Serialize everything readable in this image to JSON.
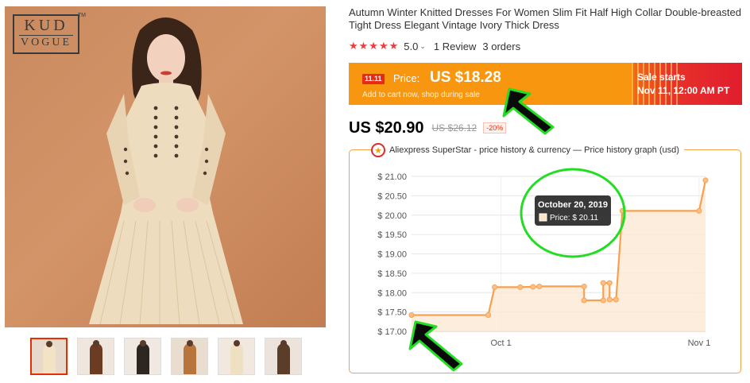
{
  "brand": {
    "logo_top": "KUD",
    "logo_bottom": "VOGUE",
    "logo_tm": "TM"
  },
  "product": {
    "title": "Autumn Winter Knitted Dresses For Women Slim Fit Half High Collar Double-breasted Tight Dress Elegant Vintage Ivory Thick Dress",
    "stars": "★★★★★",
    "rating": "5.0",
    "reviews": "1 Review",
    "orders": "3 orders",
    "current_price": "US $20.90",
    "old_price": "US $26.12",
    "discount": "-20%"
  },
  "sale": {
    "badge": "11.11",
    "price_label": "Price:",
    "price": "US $18.28",
    "subtitle": "Add to cart now, shop during sale",
    "starts_label": "Sale starts",
    "starts_date": "Nov 11, 12:00 AM PT"
  },
  "history": {
    "title": "Aliexpress SuperStar - price history & currency — Price history graph (usd)",
    "tooltip_date": "October 20, 2019",
    "tooltip_price": "Price: $ 20.11"
  },
  "colors": {
    "sale_orange": "#f9960f",
    "sale_red": "#e11d2d",
    "line": "#f9a04e",
    "area": "#fde8d4",
    "highlight_green": "#22dd22"
  },
  "thumbnails": [
    {
      "color": "#f3e2c4",
      "bg": "#e7d9cc"
    },
    {
      "color": "#6b3b22",
      "bg": "#efe6dd"
    },
    {
      "color": "#2e2620",
      "bg": "#f0e9e2"
    },
    {
      "color": "#b8743d",
      "bg": "#e9ddd0"
    },
    {
      "color": "#f0e0c2",
      "bg": "#f1e9e0"
    },
    {
      "color": "#5a3e2a",
      "bg": "#ece4dc"
    }
  ],
  "chart_data": {
    "type": "line",
    "step": true,
    "y_ticks": [
      "$ 21.00",
      "$ 20.50",
      "$ 20.00",
      "$ 19.50",
      "$ 19.00",
      "$ 18.50",
      "$ 18.00",
      "$ 17.50",
      "$ 17.00"
    ],
    "x_ticks": [
      "Oct 1",
      "Nov 1"
    ],
    "ylim": [
      17.0,
      21.0
    ],
    "xlim_days": [
      "2019-09-17",
      "2019-11-02"
    ],
    "series": [
      {
        "points": [
          {
            "x": "2019-09-17",
            "y": 17.42
          },
          {
            "x": "2019-09-29",
            "y": 17.42
          },
          {
            "x": "2019-09-30",
            "y": 18.14
          },
          {
            "x": "2019-10-04",
            "y": 18.14
          },
          {
            "x": "2019-10-06",
            "y": 18.15
          },
          {
            "x": "2019-10-07",
            "y": 18.16
          },
          {
            "x": "2019-10-14",
            "y": 18.16
          },
          {
            "x": "2019-10-14",
            "y": 17.8
          },
          {
            "x": "2019-10-17",
            "y": 17.8
          },
          {
            "x": "2019-10-17",
            "y": 18.25
          },
          {
            "x": "2019-10-18",
            "y": 18.25
          },
          {
            "x": "2019-10-18",
            "y": 17.82
          },
          {
            "x": "2019-10-19",
            "y": 17.82
          },
          {
            "x": "2019-10-20",
            "y": 20.11
          },
          {
            "x": "2019-11-01",
            "y": 20.11
          },
          {
            "x": "2019-11-02",
            "y": 20.9
          }
        ]
      }
    ],
    "grid": true
  }
}
